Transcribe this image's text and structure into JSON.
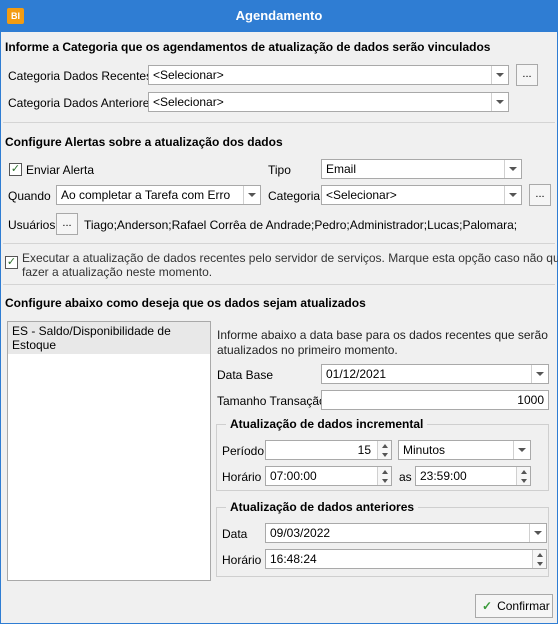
{
  "window": {
    "title": "Agendamento",
    "app_icon": "BI"
  },
  "categoria": {
    "heading": "Informe a Categoria que os agendamentos de atualização de dados serão vinculados",
    "recentes_label": "Categoria Dados Recentes",
    "recentes_value": "<Selecionar>",
    "anteriores_label": "Categoria Dados Anteriores",
    "anteriores_value": "<Selecionar>",
    "ellipsis": "..."
  },
  "alertas": {
    "heading": "Configure Alertas sobre a atualização dos dados",
    "enviar_label": "Enviar Alerta",
    "enviar_checked": true,
    "tipo_label": "Tipo",
    "tipo_value": "Email",
    "quando_label": "Quando",
    "quando_value": "Ao completar a Tarefa com Erro",
    "categoria_label": "Categoria",
    "categoria_value": "<Selecionar>",
    "usuarios_label": "Usuários",
    "usuarios_value": "Tiago;Anderson;Rafael Corrêa de Andrade;Pedro;Administrador;Lucas;Palomara;",
    "ellipsis": "..."
  },
  "executar": {
    "checked": true,
    "text_line1": "Executar a atualização de dados recentes pelo servidor de serviços.  Marque esta opção caso não queira",
    "text_line2": "fazer a atualização neste momento."
  },
  "config": {
    "heading": "Configure abaixo como deseja que os dados sejam atualizados",
    "list_items": [
      "ES - Saldo/Disponibilidade de Estoque"
    ],
    "info_line1": "Informe abaixo a data base para os dados recentes que serão",
    "info_line2": "atualizados no primeiro momento.",
    "data_base_label": "Data Base",
    "data_base_value": "01/12/2021",
    "tamanho_label": "Tamanho Transação",
    "tamanho_value": "1000"
  },
  "incremental": {
    "title": "Atualização de dados incremental",
    "periodo_label": "Período",
    "periodo_value": "15",
    "unidade_value": "Minutos",
    "horario_label": "Horário",
    "horario_inicio": "07:00:00",
    "as_label": "as",
    "horario_fim": "23:59:00"
  },
  "anteriores": {
    "title": "Atualização de dados anteriores",
    "data_label": "Data",
    "data_value": "09/03/2022",
    "horario_label": "Horário",
    "horario_value": "16:48:24"
  },
  "footer": {
    "confirm_label": "Confirmar"
  }
}
